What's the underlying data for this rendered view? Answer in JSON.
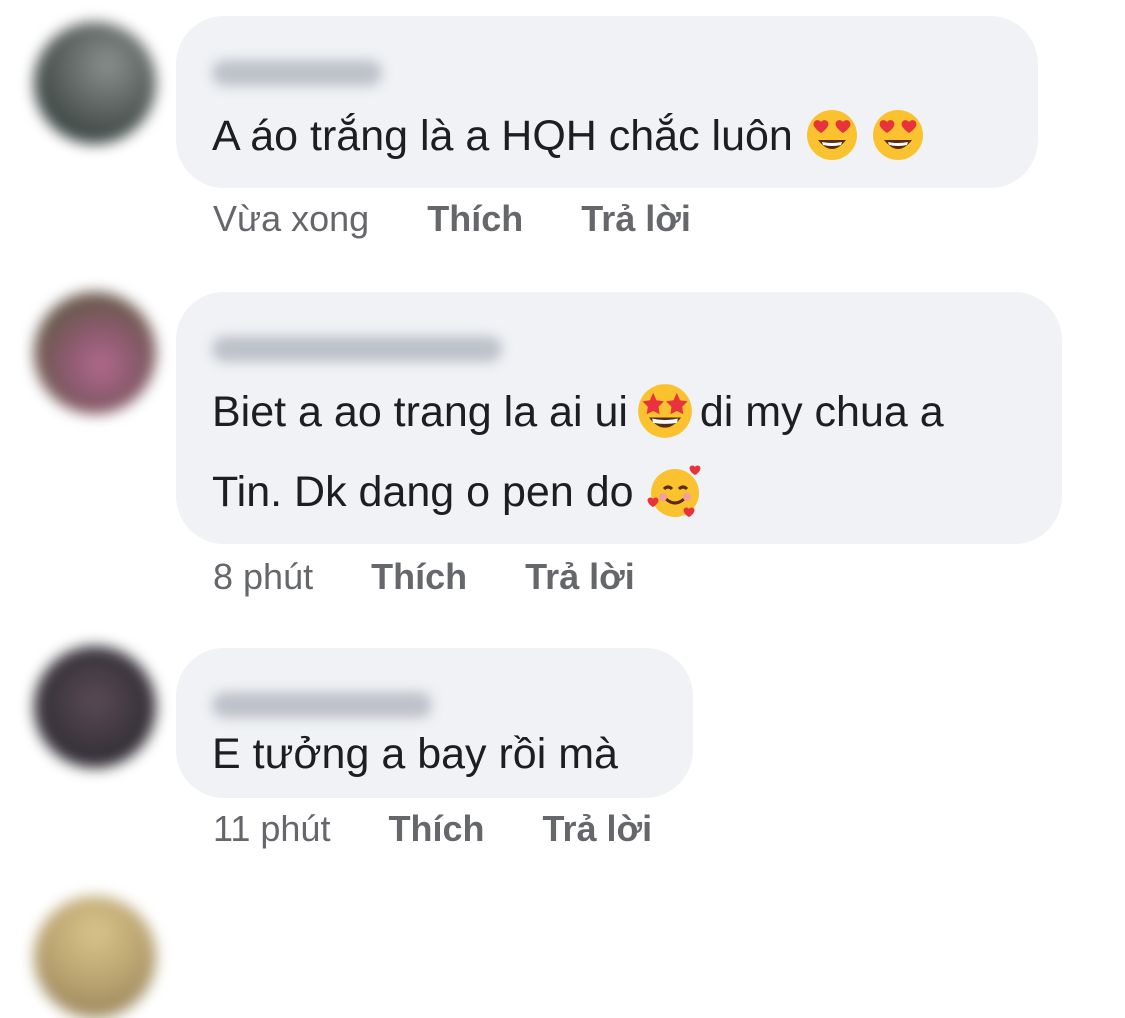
{
  "comments": [
    {
      "text": "A áo trắng là a HQH chắc luôn",
      "emojis": [
        "heart-eyes-emoji",
        "heart-eyes-emoji"
      ],
      "time": "Vừa xong",
      "like": "Thích",
      "reply": "Trả lời",
      "author_blurred": true
    },
    {
      "line1": "Biet a ao trang la ai ui",
      "emoji1": "star-struck-emoji",
      "line1b": "di my chua a",
      "line2": "Tin. Dk dang o pen do",
      "emoji2": "smiling-face-with-hearts-emoji",
      "time": "8 phút",
      "like": "Thích",
      "reply": "Trả lời",
      "author_blurred": true
    },
    {
      "text": "E tưởng a bay rồi mà",
      "time": "11 phút",
      "like": "Thích",
      "reply": "Trả lời",
      "author_blurred": true
    }
  ],
  "colors": {
    "bubble": "#f0f2f5",
    "text": "#1c1e21",
    "meta": "#65676b"
  }
}
